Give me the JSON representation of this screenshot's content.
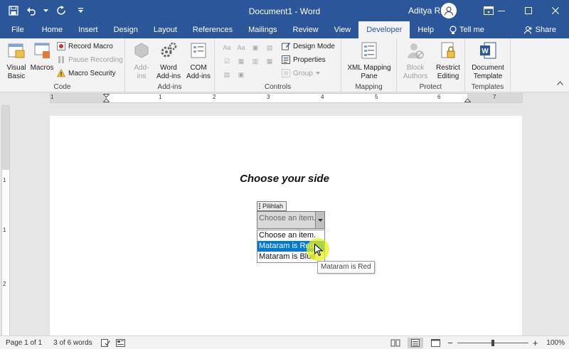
{
  "window": {
    "doc_title": "Document1 - Word",
    "user_name": "Aditya Rizky",
    "accent_color": "#2b579a"
  },
  "qat": {
    "save_icon": "save-icon",
    "undo_icon": "undo-icon",
    "redo_icon": "redo-icon",
    "customize_icon": "customize-qat-icon"
  },
  "tabs": [
    {
      "label": "File"
    },
    {
      "label": "Home"
    },
    {
      "label": "Insert"
    },
    {
      "label": "Design"
    },
    {
      "label": "Layout"
    },
    {
      "label": "References"
    },
    {
      "label": "Mailings"
    },
    {
      "label": "Review"
    },
    {
      "label": "View"
    },
    {
      "label": "Developer"
    },
    {
      "label": "Help"
    }
  ],
  "tell_me": "Tell me",
  "share": "Share",
  "ribbon": {
    "code": {
      "label": "Code",
      "visual_basic": "Visual\nBasic",
      "macros": "Macros",
      "record_macro": "Record Macro",
      "pause_recording": "Pause Recording",
      "macro_security": "Macro Security"
    },
    "addins": {
      "label": "Add-ins",
      "addins": "Add-\nins",
      "word_addins": "Word\nAdd-ins",
      "com_addins": "COM\nAdd-ins"
    },
    "controls": {
      "label": "Controls",
      "design_mode": "Design Mode",
      "properties": "Properties",
      "group": "Group"
    },
    "mapping": {
      "label": "Mapping",
      "xml_pane": "XML Mapping\nPane"
    },
    "protect": {
      "label": "Protect",
      "block_authors": "Block\nAuthors",
      "restrict_editing": "Restrict\nEditing"
    },
    "templates": {
      "label": "Templates",
      "document_template": "Document\nTemplate"
    }
  },
  "ruler": {
    "h_numbers": [
      "1",
      "1",
      "2",
      "3",
      "4",
      "5",
      "6",
      "7"
    ],
    "v_numbers": [
      "1",
      "1",
      "2"
    ]
  },
  "document": {
    "heading": "Choose your side",
    "content_control": {
      "tag": "Pilihlah",
      "value": "Choose an item.",
      "options": [
        "Choose an item.",
        "Mataram is Red",
        "Mataram is Blue"
      ],
      "selected_index": 1
    },
    "tooltip": "Mataram is Red"
  },
  "statusbar": {
    "page": "Page 1 of 1",
    "words": "3 of 6 words",
    "zoom": "100%",
    "zoom_level_percent": 100
  }
}
